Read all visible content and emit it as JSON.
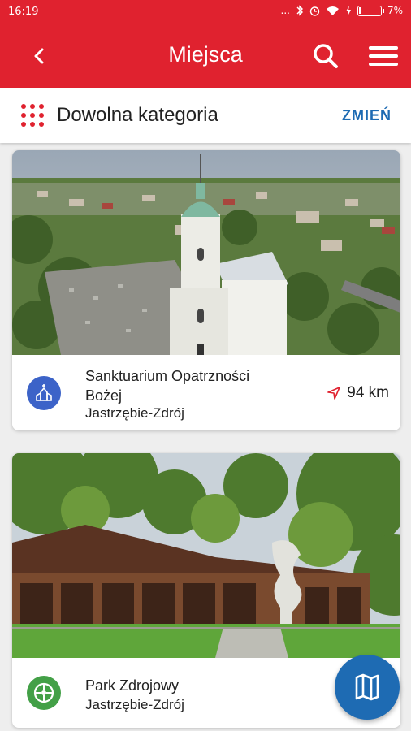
{
  "status_bar": {
    "time": "16:19",
    "signal_text": "...",
    "battery_percent_text": "7%",
    "battery_level": 0.07
  },
  "app_bar": {
    "title": "Miejsca",
    "back_icon": "chevron-left-icon",
    "search_icon": "search-icon",
    "menu_icon": "hamburger-menu-icon"
  },
  "category_bar": {
    "icon": "grid-dots-icon",
    "label": "Dowolna kategoria",
    "change_label": "ZMIEŃ"
  },
  "places": [
    {
      "name": "Sanktuarium Opatrzności Bożej",
      "city": "Jastrzębie-Zdrój",
      "distance": "94 km",
      "category_icon": "church-icon",
      "category_color": "#3c63c8"
    },
    {
      "name": "Park Zdrojowy",
      "city": "Jastrzębie-Zdrój",
      "distance": "",
      "category_icon": "park-icon",
      "category_color": "#43a047"
    }
  ],
  "fab": {
    "icon": "map-icon"
  },
  "colors": {
    "primary": "#e0222f",
    "accent": "#1e6bb3"
  }
}
